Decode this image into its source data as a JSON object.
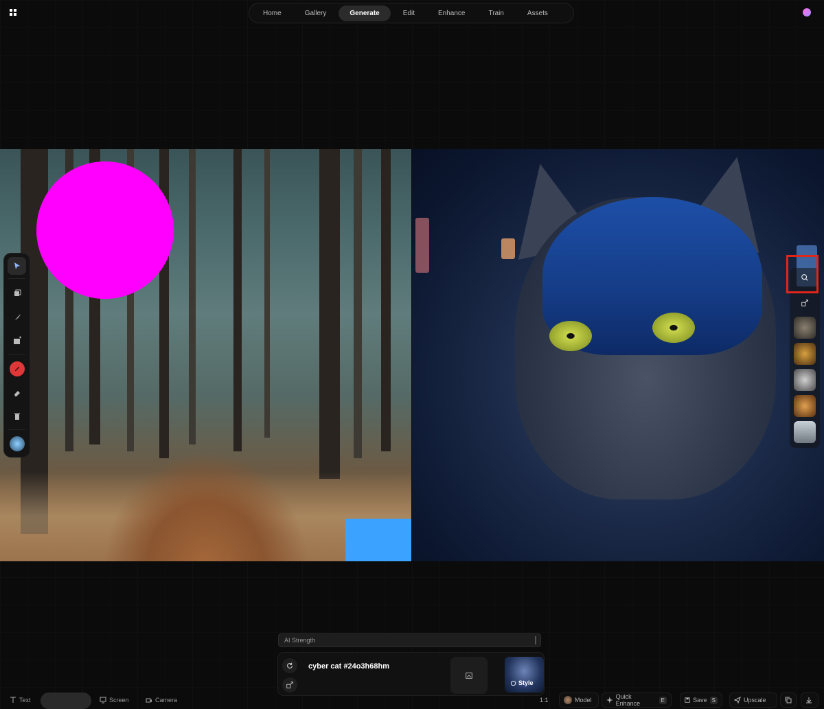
{
  "nav": {
    "tabs": [
      "Home",
      "Gallery",
      "Generate",
      "Edit",
      "Enhance",
      "Train",
      "Assets"
    ],
    "active": "Generate"
  },
  "colors": {
    "magenta_shape": "#ff00ff",
    "blue_shape": "#3ba2ff",
    "highlight_box": "#e0261a",
    "brush_color": "#e03838"
  },
  "left_toolbar": {
    "tools": [
      "select-icon",
      "layers-icon",
      "brush-icon",
      "image-icon",
      "color-icon",
      "eraser-icon",
      "trash-icon",
      "avatar-icon"
    ]
  },
  "right_toolbar": {
    "tools": [
      "search-icon",
      "share-icon"
    ],
    "thumbnails": 6
  },
  "prompt": {
    "strength_label": "AI Strength",
    "text": "cyber cat #24o3h68hm",
    "style_label": "Style"
  },
  "bottom_left": {
    "text_label": "Text",
    "screen_label": "Screen",
    "camera_label": "Camera"
  },
  "bottom_right": {
    "ratio": "1:1",
    "model": "Model",
    "quick_enhance": "Quick Enhance",
    "quick_enhance_key": "E",
    "save": "Save",
    "save_key": "S",
    "upscale": "Upscale"
  }
}
